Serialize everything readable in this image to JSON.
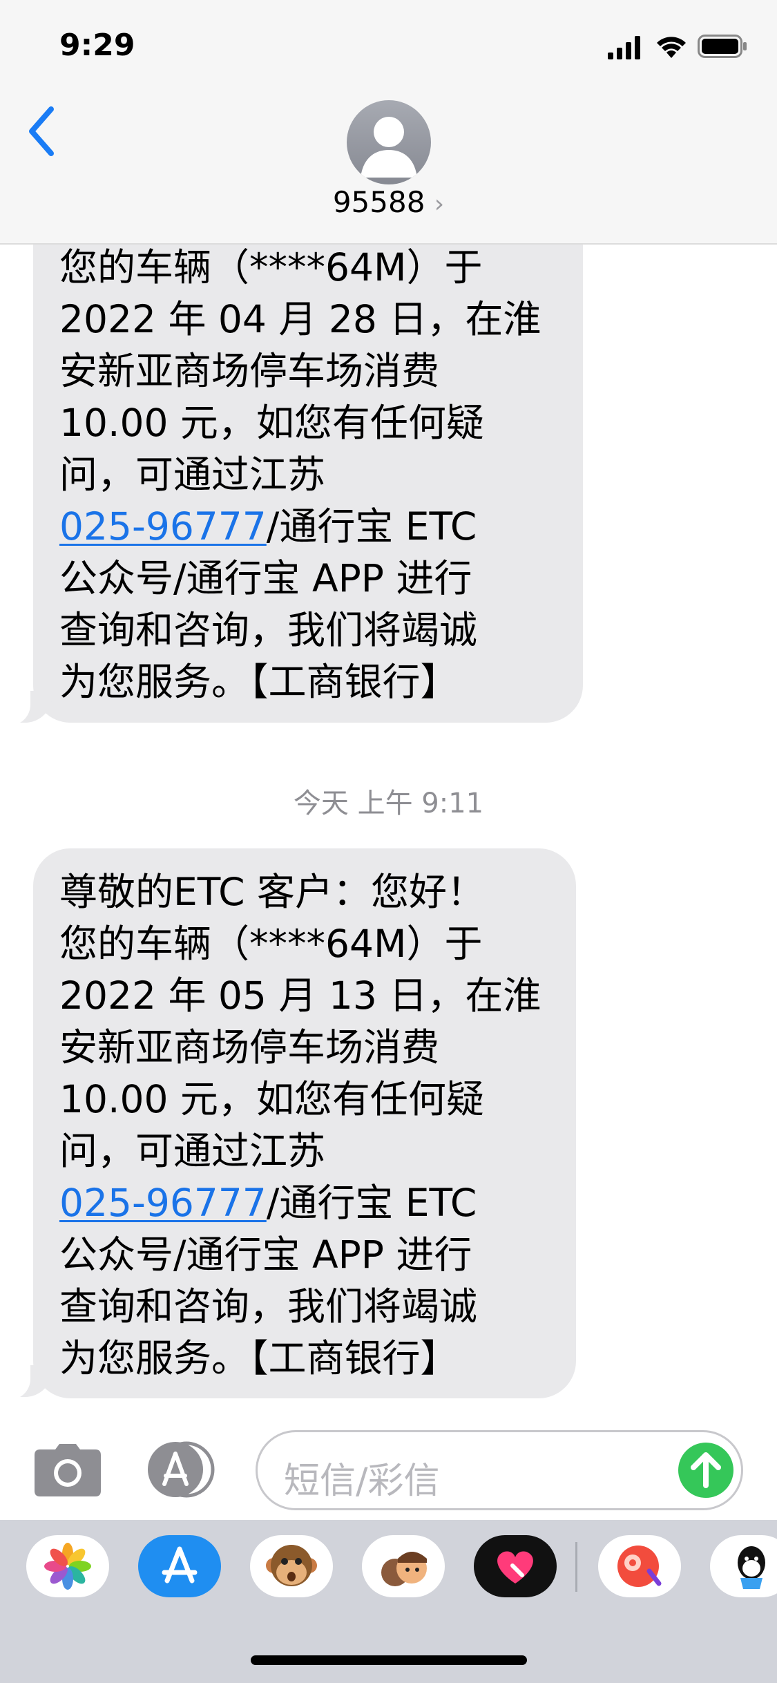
{
  "status_bar": {
    "time": "9:29"
  },
  "header": {
    "contact": "95588",
    "chevron": "›"
  },
  "messages": {
    "first": {
      "lines": [
        "您的车辆（****64M）于",
        "2022 年 04 月 28 日，在淮",
        "安新亚商场停车场消费",
        "10.00 元，如您有任何疑",
        "问，可通过江苏",
        "025-96777",
        "/通行宝 ETC",
        "公众号/通行宝 APP 进行",
        "查询和咨询，我们将竭诚",
        "为您服务。【工商银行】"
      ]
    },
    "timestamp": "今天 上午 9:11",
    "second": {
      "lines": [
        "尊敬的ETC 客户：您好！",
        "您的车辆（****64M）于",
        "2022 年 05 月 13 日，在淮",
        "安新亚商场停车场消费",
        "10.00 元，如您有任何疑",
        "问，可通过江苏",
        "025-96777",
        "/通行宝 ETC",
        "公众号/通行宝 APP 进行",
        "查询和咨询，我们将竭诚",
        "为您服务。【工商银行】"
      ]
    }
  },
  "input": {
    "placeholder": "短信/彩信"
  },
  "app_strip": [
    "photos-icon",
    "app-store-icon",
    "animoji-monkey-icon",
    "memoji-icon",
    "digital-touch-icon",
    "music-app-icon",
    "qq-icon"
  ],
  "colors": {
    "link": "#1a73e8",
    "send": "#35c759",
    "bubble": "#e9e9eb"
  }
}
